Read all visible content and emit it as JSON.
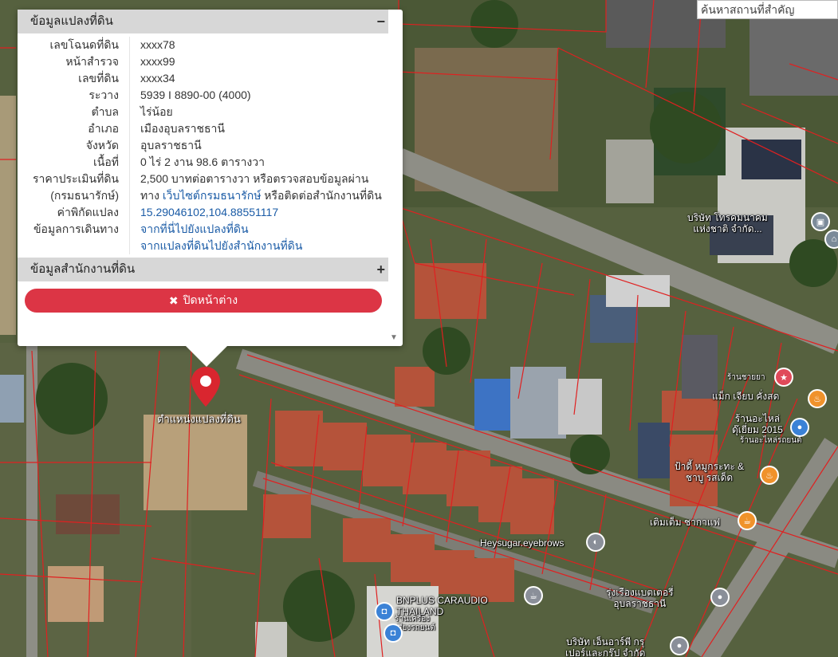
{
  "search": {
    "placeholder": "ค้นหาสถานที่สำคัญ"
  },
  "popup": {
    "section1_title": "ข้อมูลแปลงที่ดิน",
    "section1_toggle": "−",
    "rows": [
      {
        "key": "เลขโฉนดที่ดิน",
        "value": "xxxx78"
      },
      {
        "key": "หน้าสำรวจ",
        "value": "xxxx99"
      },
      {
        "key": "เลขที่ดิน",
        "value": "xxxx34"
      },
      {
        "key": "ระวาง",
        "value": "5939 I 8890-00 (4000)"
      },
      {
        "key": "ตำบล",
        "value": "ไร่น้อย"
      },
      {
        "key": "อำเภอ",
        "value": "เมืองอุบลราชธานี"
      },
      {
        "key": "จังหวัด",
        "value": "อุบลราชธานี"
      },
      {
        "key": "เนื้อที่",
        "value": "0 ไร่ 2 งาน 98.6 ตารางวา"
      }
    ],
    "price_key": "ราคาประเมินที่ดิน",
    "price_key2": "(กรมธนารักษ์)",
    "price_line1": "2,500 บาทต่อตารางวา หรือตรวจสอบข้อมูลผ่าน",
    "price_line2_pre": "ทาง ",
    "price_link": "เว็บไซต์กรมธนารักษ์",
    "price_line2_post": " หรือติดต่อสำนักงานที่ดิน",
    "coord_key": "ค่าพิกัดแปลง",
    "coord_value": "15.29046102,104.88551117",
    "travel_key": "ข้อมูลการเดินทาง",
    "travel_link1": "จากที่นี่ไปยังแปลงที่ดิน",
    "travel_link2": "จากแปลงที่ดินไปยังสำนักงานที่ดิน",
    "section2_title": "ข้อมูลสำนักงานที่ดิน",
    "section2_toggle": "+",
    "close_label": "ปิดหน้าต่าง",
    "close_icon": "✖"
  },
  "marker_label": "ตำแหน่งแปลงที่ดิน",
  "pois": {
    "telecom": "บริษัท โทรคมนาคม\nแห่งชาติ จำกัด...",
    "shop_sayaya": "ร้านชายยา",
    "maek_jiap": "แม็ก เจียบ คั่งสด",
    "auto_parts": "ร้านอะไหล่\nดุ๊เยี่ยม 2015",
    "auto_parts_sub": "ร้านอะไหล่รถยนต์",
    "pa_mu": "ป้าดี้ หมูกระทะ &\nชาบู รสเด็ด",
    "toem_tem": "เติมเต็ม ชากาแฟ",
    "heysugar": "Heysugar.eyebrows",
    "rungrueang": "รุ่งเรืองแบตเตอรี่\nอุบลราชธานี",
    "bnplus": "BNPLUS CARAUDIO\nTHAILAND",
    "bnplus_sub": "ร้านเครื่อง\nเสียงรถยนต์",
    "company_bottom": "บริษัท เอ็นอาร์พี กรุ\nเปอร์และกรุ๊ป จำกัด"
  },
  "colors": {
    "close": "#dc3545",
    "link": "#1a5ba6",
    "parcel": "#e02020",
    "marker": "#d9262f"
  }
}
